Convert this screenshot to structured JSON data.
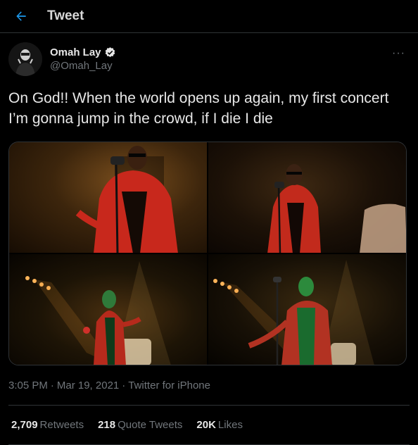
{
  "header": {
    "title": "Tweet",
    "back_icon": "arrow-left-icon"
  },
  "author": {
    "name": "Omah Lay",
    "handle": "@Omah_Lay",
    "verified": true,
    "more_label": "···"
  },
  "tweet": {
    "text": "On God!! When the world opens up again, my first concert I’m gonna jump in the crowd, if I die I die"
  },
  "meta": {
    "time": "3:05 PM",
    "separator": "·",
    "date": "Mar 19, 2021",
    "source": "Twitter for iPhone"
  },
  "stats": [
    {
      "value": "2,709",
      "label": "Retweets"
    },
    {
      "value": "218",
      "label": "Quote Tweets"
    },
    {
      "value": "20K",
      "label": "Likes"
    }
  ],
  "colors": {
    "accent": "#1d9bf0",
    "background": "#000000",
    "muted": "#71767b",
    "jacket_red": "#c0281e"
  }
}
